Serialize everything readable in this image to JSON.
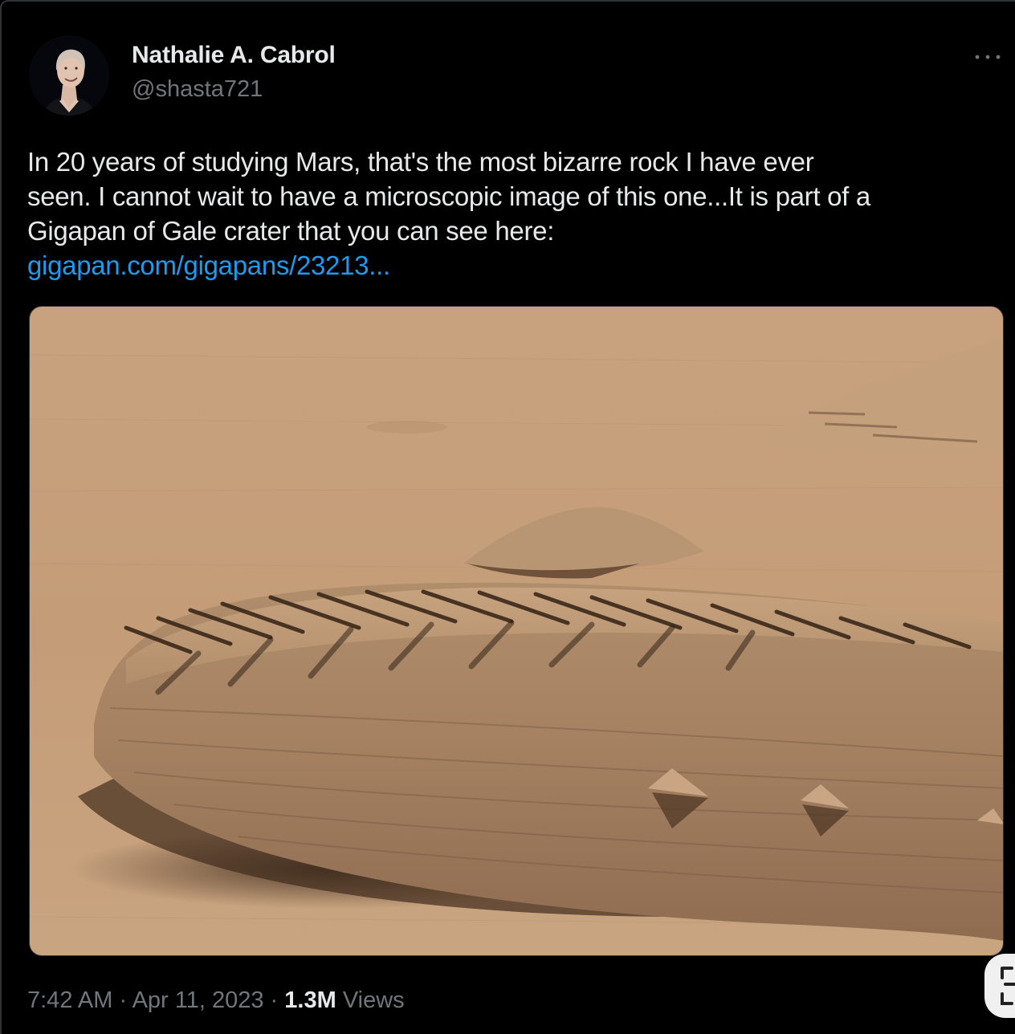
{
  "author": {
    "display_name": "Nathalie A. Cabrol",
    "handle": "@shasta721",
    "avatar_icon": "profile-photo"
  },
  "tweet": {
    "lines": [
      "In 20 years of studying Mars, that's the most bizarre rock I have ever",
      "seen. I cannot wait to have a microscopic image of this one...It is part of a",
      "Gigapan of Gale crater that you can see here:"
    ],
    "link_text": "gigapan.com/gigapans/23213..."
  },
  "meta": {
    "time": "7:42 AM",
    "separator_1": " · ",
    "date": "Apr 11, 2023",
    "separator_2": " · ",
    "views_count": "1.3M",
    "views_label": " Views"
  },
  "icons": {
    "more": "more-horizontal-icon",
    "side_button": "scan-icon"
  },
  "colors": {
    "background": "#000000",
    "text": "#e7e9ea",
    "muted": "#71767b",
    "link": "#1d9bf0",
    "sand": "#c9a27c",
    "rock": "#a98561"
  }
}
